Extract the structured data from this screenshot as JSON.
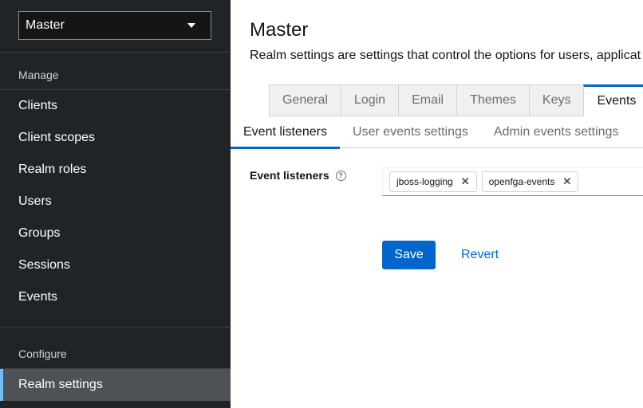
{
  "sidebar": {
    "realm_selector": "Master",
    "manage_title": "Manage",
    "manage_items": [
      "Clients",
      "Client scopes",
      "Realm roles",
      "Users",
      "Groups",
      "Sessions",
      "Events"
    ],
    "configure_title": "Configure",
    "configure_items": [
      "Realm settings"
    ]
  },
  "header": {
    "title": "Master",
    "description": "Realm settings are settings that control the options for users, applicat"
  },
  "tabs": [
    "General",
    "Login",
    "Email",
    "Themes",
    "Keys",
    "Events"
  ],
  "active_tab": "Events",
  "subtabs": [
    "Event listeners",
    "User events settings",
    "Admin events settings"
  ],
  "active_subtab": "Event listeners",
  "form": {
    "event_listeners_label": "Event listeners",
    "chips": [
      "jboss-logging",
      "openfga-events"
    ],
    "save_label": "Save",
    "revert_label": "Revert"
  },
  "colors": {
    "sidebar_bg": "#212427",
    "accent": "#0066cc",
    "active_nav_border": "#73bcf7"
  }
}
